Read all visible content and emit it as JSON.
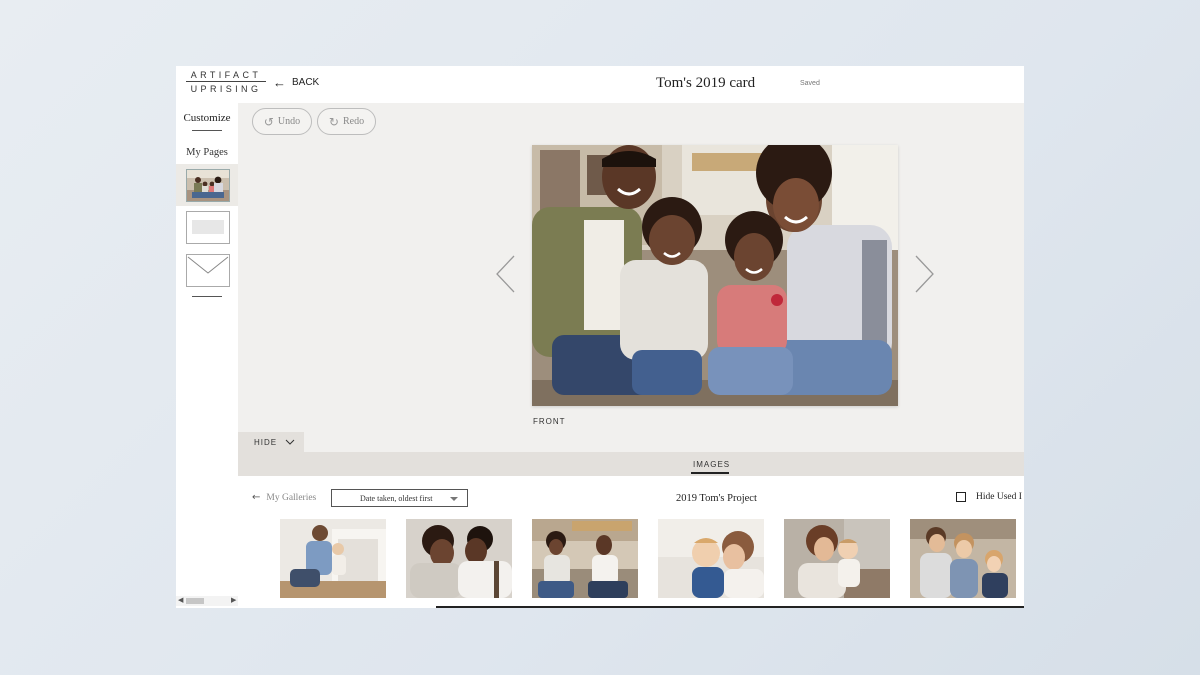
{
  "app": {
    "logo_top": "ARTIFACT",
    "logo_bottom": "UPRISING",
    "back_label": "BACK",
    "document_title": "Tom's 2019 card",
    "save_status": "Saved"
  },
  "sidebar": {
    "customize_label": "Customize",
    "my_pages_label": "My Pages"
  },
  "toolbar": {
    "undo_label": "Undo",
    "redo_label": "Redo"
  },
  "canvas": {
    "page_label": "FRONT"
  },
  "panel": {
    "hide_label": "HIDE",
    "tabs": [
      {
        "label": "IMAGES",
        "active": true
      }
    ],
    "my_galleries_label": "My Galleries",
    "sort_selected": "Date taken, oldest first",
    "project_title": "2019 Tom's Project",
    "hide_used_label": "Hide Used I",
    "hide_used_checked": false
  },
  "icons": {
    "back": "arrow-left-icon",
    "undo": "undo-icon",
    "redo": "redo-icon",
    "prev": "chevron-left-icon",
    "next": "chevron-right-icon",
    "hide": "chevron-down-icon",
    "dropdown": "caret-down-icon",
    "envelope": "envelope-icon"
  },
  "colors": {
    "canvas_bg": "#f1f0ee",
    "panel_tab_bg": "#e3e0dc",
    "text_dark": "#222222",
    "text_muted": "#888888"
  }
}
